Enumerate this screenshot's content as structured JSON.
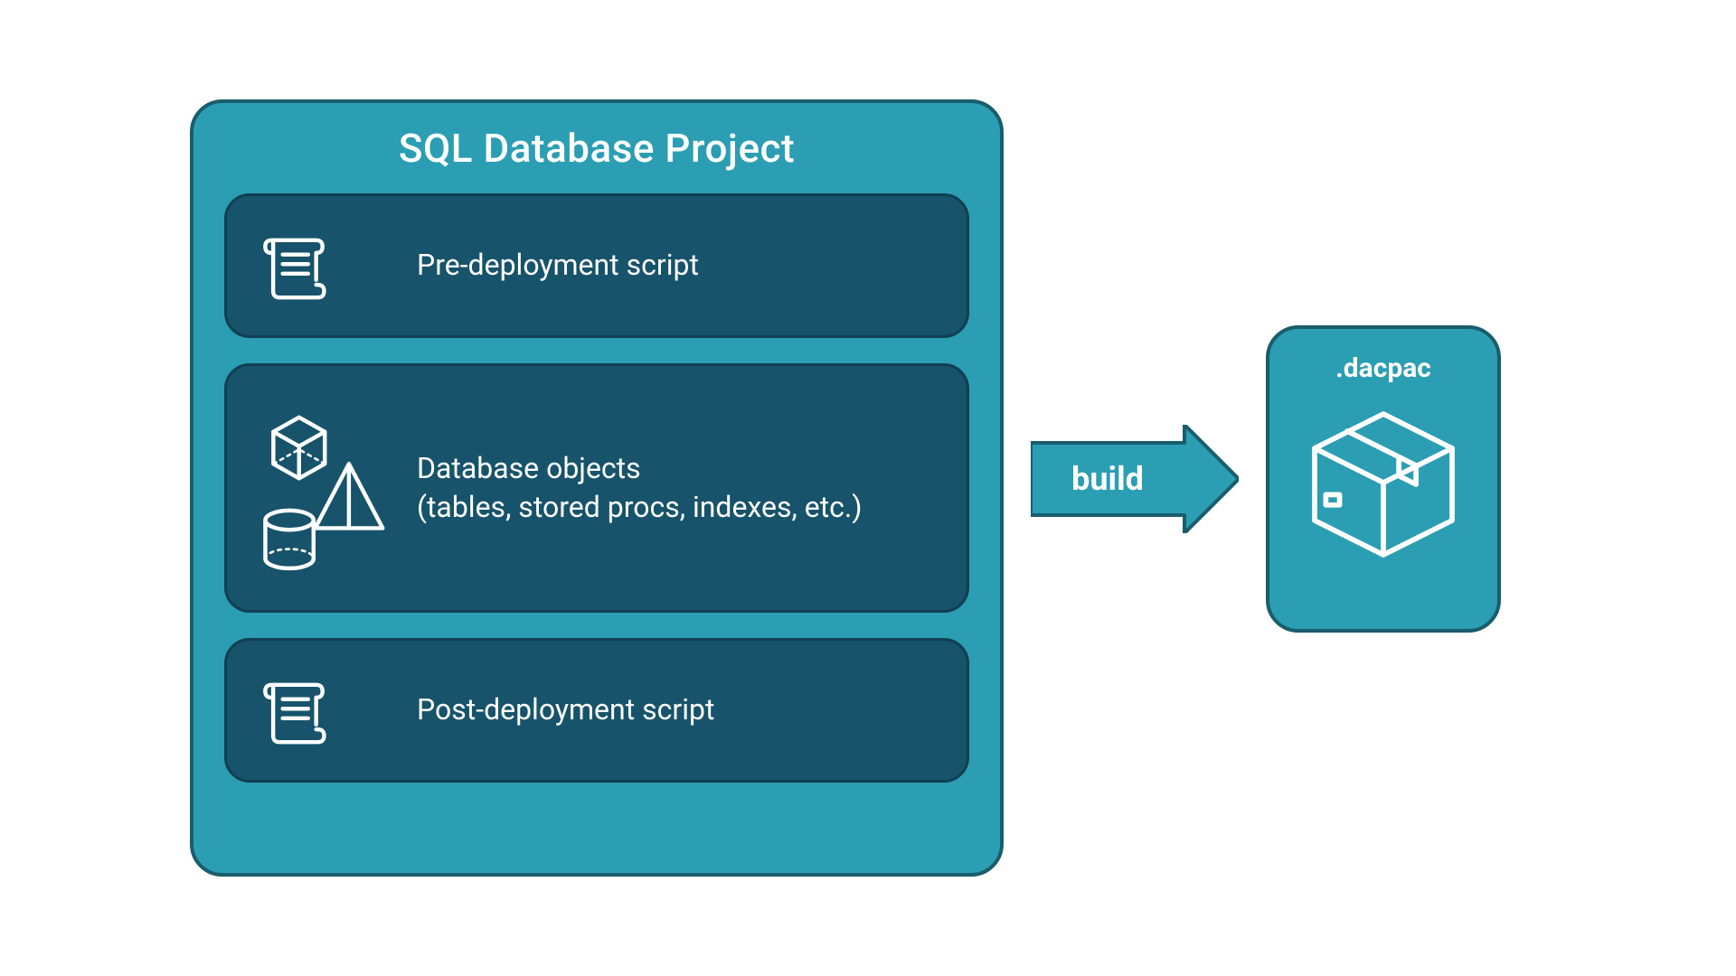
{
  "project": {
    "title": "SQL Database Project",
    "pre": {
      "label": "Pre-deployment script"
    },
    "objects": {
      "label_line1": "Database objects",
      "label_line2": "(tables, stored procs, indexes, etc.)"
    },
    "post": {
      "label": "Post-deployment script"
    }
  },
  "arrow": {
    "label": "build"
  },
  "dacpac": {
    "label": ".dacpac"
  },
  "colors": {
    "container_bg": "#2b9eb3",
    "container_border": "#1a5d6c",
    "card_bg": "#17536a",
    "card_border": "#113f52",
    "text": "#ffffff"
  }
}
